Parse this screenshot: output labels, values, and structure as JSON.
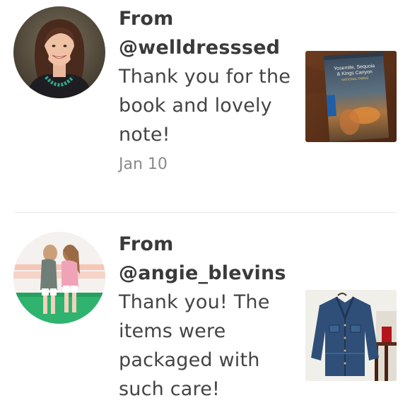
{
  "notes": [
    {
      "from_label": "From",
      "handle": "@welldresssed",
      "message": "Thank you for the book and lovely note!",
      "date": "Jan 10",
      "thumb_text_line1": "Yosemite, Sequoia",
      "thumb_text_line2": "& Kings Canyon",
      "thumb_text_line3": "NATIONAL PARKS"
    },
    {
      "from_label": "From",
      "handle": "@angie_blevins",
      "message": "Thank you! The items were packaged with such care!",
      "date": ""
    }
  ],
  "colors": {
    "text": "#3a3a3a",
    "muted": "#8a8a8a",
    "divider": "#e6e6e6"
  }
}
